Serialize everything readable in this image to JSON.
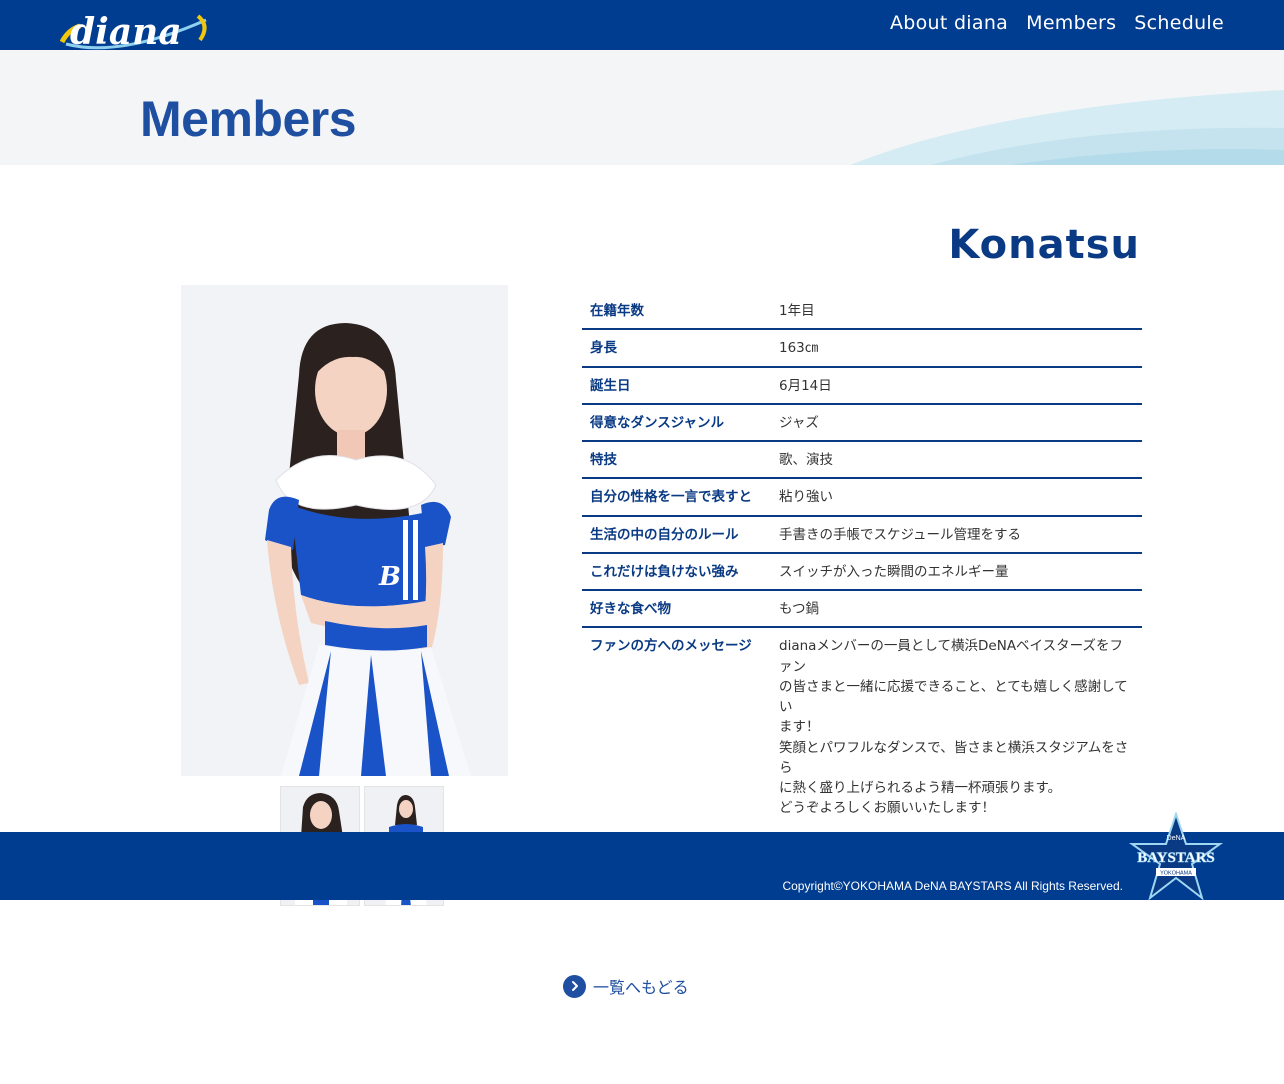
{
  "header": {
    "logo_text": "diana",
    "nav": [
      {
        "label": "About diana"
      },
      {
        "label": "Members"
      },
      {
        "label": "Schedule"
      }
    ]
  },
  "banner": {
    "title": "Members"
  },
  "member": {
    "name": "Konatsu",
    "profile": [
      {
        "key": "在籍年数",
        "value": "1年目"
      },
      {
        "key": "身長",
        "value": "163㎝"
      },
      {
        "key": "誕生日",
        "value": "6月14日"
      },
      {
        "key": "得意なダンスジャンル",
        "value": "ジャズ"
      },
      {
        "key": "特技",
        "value": "歌、演技"
      },
      {
        "key": "自分の性格を一言で表すと",
        "value": "粘り強い"
      },
      {
        "key": "生活の中の自分のルール",
        "value": "手書きの手帳でスケジュール管理をする"
      },
      {
        "key": "これだけは負けない強み",
        "value": "スイッチが入った瞬間のエネルギー量"
      },
      {
        "key": "好きな食べ物",
        "value": "もつ鍋"
      },
      {
        "key": "ファンの方へのメッセージ",
        "value_lines": [
          "dianaメンバーの一員として横浜DeNAベイスターズをファン",
          "の皆さまと一緒に応援できること、とても嬉しく感謝してい",
          "ます！",
          "笑顔とパワフルなダンスで、皆さまと横浜スタジアムをさら",
          "に熱く盛り上げられるよう精一杯頑張ります。",
          "どうぞよろしくお願いいたします！"
        ]
      }
    ]
  },
  "footer": {
    "copyright": "Copyright©YOKOHAMA DeNA BAYSTARS All Rights Reserved.",
    "logo_top": "DeNA",
    "logo_main": "BAYSTARS",
    "logo_bottom": "YOKOHAMA"
  },
  "back_link": {
    "label": "一覧へもどる"
  },
  "colors": {
    "navy": "#003c8f",
    "title_blue": "#1f4fa0",
    "text_navy": "#0a3a84",
    "banner_bg": "#f4f5f6"
  }
}
